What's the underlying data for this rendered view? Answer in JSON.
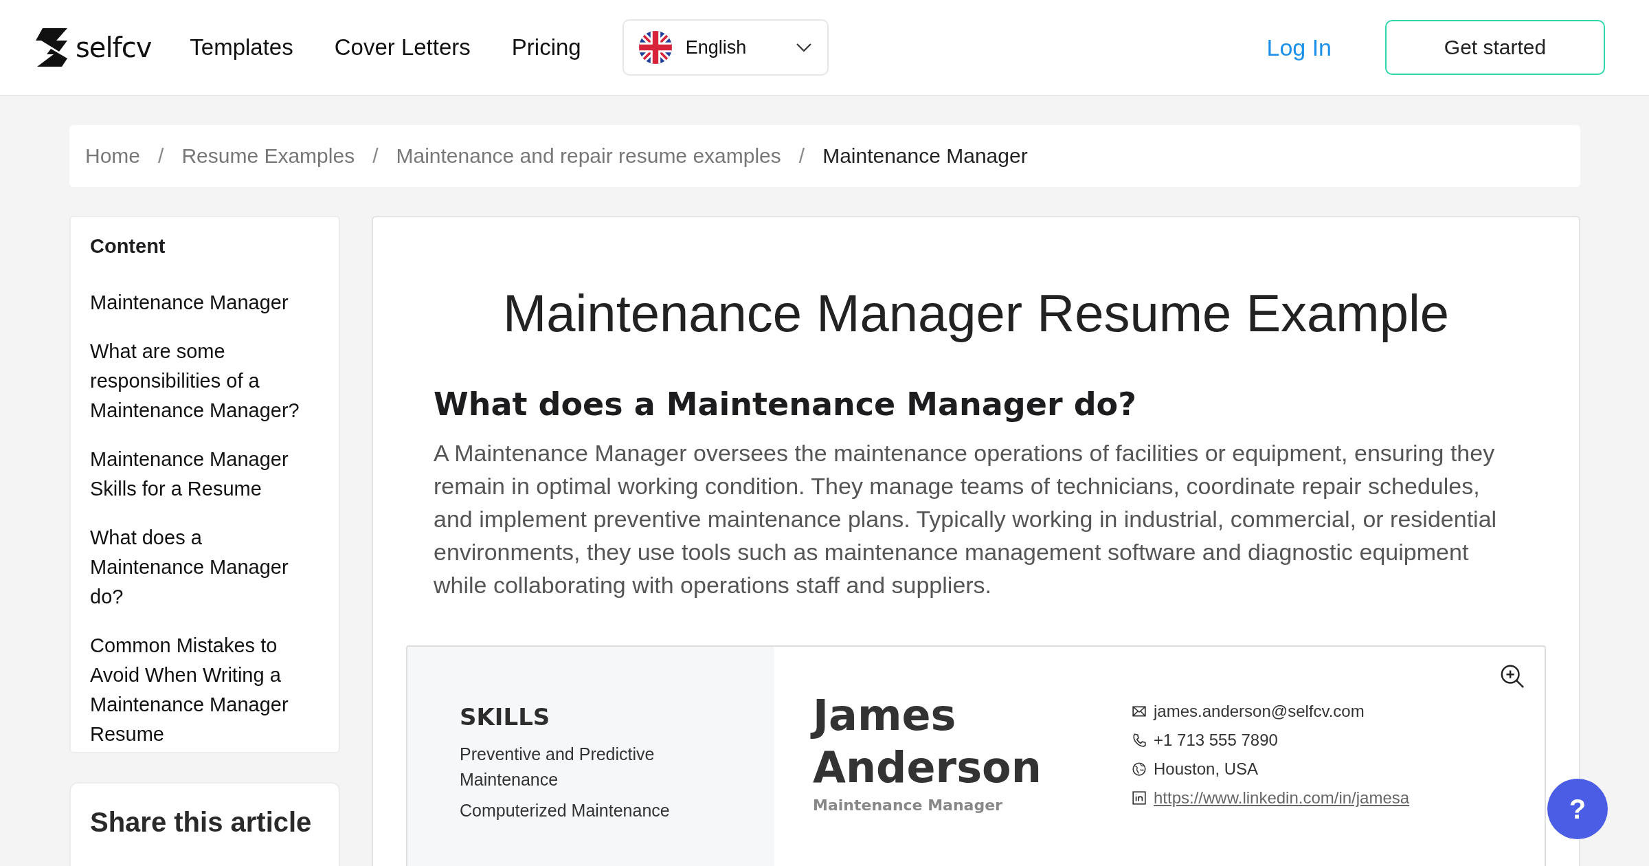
{
  "header": {
    "logo_text": "selfcv",
    "nav": [
      "Templates",
      "Cover Letters",
      "Pricing"
    ],
    "language": {
      "label": "English"
    },
    "login": "Log In",
    "cta": "Get started"
  },
  "breadcrumb": [
    {
      "label": "Home",
      "current": false
    },
    {
      "label": "Resume Examples",
      "current": false
    },
    {
      "label": "Maintenance and repair resume examples",
      "current": false
    },
    {
      "label": "Maintenance Manager",
      "current": true
    }
  ],
  "separator": "/",
  "sidebar": {
    "title": "Content",
    "items": [
      "Maintenance Manager",
      "What are some responsibilities of a Maintenance Manager?",
      "Maintenance Manager Skills for a Resume",
      "What does a Maintenance Manager do?",
      "Common Mistakes to Avoid When Writing a Maintenance Manager Resume"
    ]
  },
  "share": {
    "title": "Share this article"
  },
  "article": {
    "title": "Maintenance Manager Resume Example",
    "heading": "What does a Maintenance Manager do?",
    "paragraph": "A Maintenance Manager oversees the maintenance operations of facilities or equipment, ensuring they remain in optimal working condition. They manage teams of technicians, coordinate repair schedules, and implement preventive maintenance plans. Typically working in industrial, commercial, or residential environments, they use tools such as maintenance management software and diagnostic equipment while collaborating with operations staff and suppliers."
  },
  "resume": {
    "skills_heading": "SKILLS",
    "skills": [
      "Preventive and Predictive Maintenance",
      "Computerized Maintenance"
    ],
    "name_lines": [
      "James",
      "Anderson"
    ],
    "job_title": "Maintenance Manager",
    "contacts": [
      {
        "kind": "email",
        "text": "james.anderson@selfcv.com"
      },
      {
        "kind": "phone",
        "text": "+1 713 555 7890"
      },
      {
        "kind": "location",
        "text": "Houston, USA"
      },
      {
        "kind": "linkedin",
        "text": "https://www.linkedin.com/in/jamesa"
      }
    ]
  },
  "help_button": "?"
}
